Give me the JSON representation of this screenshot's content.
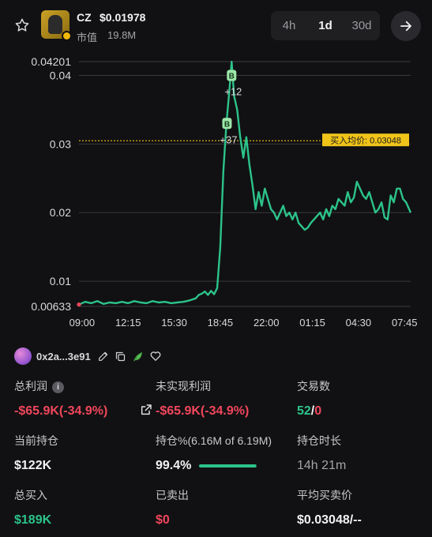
{
  "token": {
    "symbol": "CZ",
    "price": "$0.01978",
    "market_cap_label": "市值",
    "market_cap_value": "19.8M"
  },
  "timeframes": [
    {
      "label": "4h",
      "active": false
    },
    {
      "label": "1d",
      "active": true
    },
    {
      "label": "30d",
      "active": false
    }
  ],
  "icons": {
    "favorite": "star-outline-icon",
    "go": "arrow-right-icon",
    "edit": "pencil-icon",
    "copy": "copy-icon",
    "tag": "leaf-icon",
    "like": "heart-outline-icon",
    "share": "external-share-icon",
    "info": "info-icon"
  },
  "colors": {
    "up": "#2cc38a",
    "down": "#f0465c",
    "avg_line": "#f0c419",
    "buy_marker": "#9ee6a8",
    "background": "#111113"
  },
  "chart_data": {
    "type": "line",
    "x_labels": [
      "09:00",
      "12:15",
      "15:30",
      "18:45",
      "22:00",
      "01:15",
      "04:30",
      "07:45"
    ],
    "y_ticks": [
      "0.04201",
      "0.04",
      "0.03",
      "0.02",
      "0.01",
      "0.00633"
    ],
    "y_tick_values": [
      0.04201,
      0.04,
      0.03,
      0.02,
      0.01,
      0.00633
    ],
    "ylim": [
      0.00633,
      0.04201
    ],
    "xlim": [
      0,
      100
    ],
    "grid": true,
    "series": [
      {
        "values": [
          [
            0,
            0.0066
          ],
          [
            2,
            0.007
          ],
          [
            4,
            0.0068
          ],
          [
            6,
            0.0071
          ],
          [
            8,
            0.0067
          ],
          [
            10,
            0.0069
          ],
          [
            12,
            0.0068
          ],
          [
            14,
            0.007
          ],
          [
            16,
            0.0068
          ],
          [
            18,
            0.0071
          ],
          [
            20,
            0.0069
          ],
          [
            22,
            0.0068
          ],
          [
            24,
            0.0071
          ],
          [
            26,
            0.0069
          ],
          [
            28,
            0.007
          ],
          [
            30,
            0.0068
          ],
          [
            32,
            0.0069
          ],
          [
            34,
            0.007
          ],
          [
            36,
            0.0072
          ],
          [
            38,
            0.0075
          ],
          [
            39,
            0.008
          ],
          [
            40,
            0.0082
          ],
          [
            41,
            0.0085
          ],
          [
            42,
            0.008
          ],
          [
            43,
            0.0086
          ],
          [
            44,
            0.0081
          ],
          [
            45,
            0.009
          ],
          [
            46,
            0.015
          ],
          [
            47,
            0.026
          ],
          [
            48,
            0.033
          ],
          [
            49,
            0.038
          ],
          [
            49.7,
            0.042
          ],
          [
            50.5,
            0.037
          ],
          [
            51.5,
            0.035
          ],
          [
            52.5,
            0.031
          ],
          [
            53.5,
            0.028
          ],
          [
            54.5,
            0.031
          ],
          [
            55.5,
            0.027
          ],
          [
            56.5,
            0.024
          ],
          [
            57.5,
            0.0205
          ],
          [
            58.5,
            0.023
          ],
          [
            59.5,
            0.021
          ],
          [
            60.5,
            0.0235
          ],
          [
            61.5,
            0.022
          ],
          [
            62.5,
            0.0205
          ],
          [
            63.5,
            0.02
          ],
          [
            64.5,
            0.019
          ],
          [
            65.5,
            0.02
          ],
          [
            66.5,
            0.021
          ],
          [
            67.5,
            0.0195
          ],
          [
            68.5,
            0.02
          ],
          [
            69.5,
            0.019
          ],
          [
            70.5,
            0.02
          ],
          [
            71.5,
            0.0185
          ],
          [
            72.5,
            0.018
          ],
          [
            73.5,
            0.0175
          ],
          [
            74.5,
            0.0178
          ],
          [
            75.5,
            0.0185
          ],
          [
            76.5,
            0.019
          ],
          [
            77.5,
            0.0195
          ],
          [
            78.5,
            0.02
          ],
          [
            79.5,
            0.019
          ],
          [
            80.5,
            0.0205
          ],
          [
            81.5,
            0.0195
          ],
          [
            82.5,
            0.021
          ],
          [
            83.5,
            0.0205
          ],
          [
            84.5,
            0.022
          ],
          [
            85.5,
            0.0215
          ],
          [
            86.5,
            0.021
          ],
          [
            87.5,
            0.023
          ],
          [
            88.5,
            0.0215
          ],
          [
            89.5,
            0.0222
          ],
          [
            90.5,
            0.0245
          ],
          [
            91.5,
            0.0235
          ],
          [
            92.5,
            0.0225
          ],
          [
            93.5,
            0.022
          ],
          [
            94.5,
            0.023
          ],
          [
            95.5,
            0.0215
          ],
          [
            96.5,
            0.02
          ],
          [
            97.5,
            0.0205
          ],
          [
            98.5,
            0.0215
          ],
          [
            99.5,
            0.0193
          ],
          [
            100.5,
            0.019
          ],
          [
            101.5,
            0.0225
          ],
          [
            102.5,
            0.0215
          ],
          [
            103.5,
            0.0235
          ],
          [
            104.5,
            0.0235
          ],
          [
            105.5,
            0.022
          ],
          [
            106.5,
            0.0215
          ],
          [
            108,
            0.02
          ]
        ]
      }
    ],
    "buy_markers": [
      {
        "x": 49.7,
        "y": 0.04,
        "letter": "B",
        "label": "+12"
      },
      {
        "x": 48.2,
        "y": 0.033,
        "letter": "B",
        "label": "+37"
      }
    ],
    "avg_buy_line": {
      "value": 0.03048,
      "label": "买入均价: 0.03048"
    }
  },
  "wallet": {
    "address": "0x2a...3e91"
  },
  "stats": {
    "total_pnl": {
      "label": "总利润",
      "value": "-$65.9K(-34.9%)"
    },
    "unrealized_pnl": {
      "label": "未实现利润",
      "value": "-$65.9K(-34.9%)"
    },
    "trades": {
      "label": "交易数",
      "buys": "52",
      "separator": "/",
      "sells": "0"
    },
    "holding": {
      "label": "当前持仓",
      "value": "$122K"
    },
    "holding_pct": {
      "label": "持仓%(6.16M of 6.19M)",
      "value": "99.4%",
      "fill": 0.994
    },
    "hold_duration": {
      "label": "持仓时长",
      "value": "14h 21m"
    },
    "total_bought": {
      "label": "总买入",
      "value": "$189K"
    },
    "sold": {
      "label": "已卖出",
      "value": "$0"
    },
    "avg_price": {
      "label": "平均买卖价",
      "value": "$0.03048/--"
    }
  }
}
